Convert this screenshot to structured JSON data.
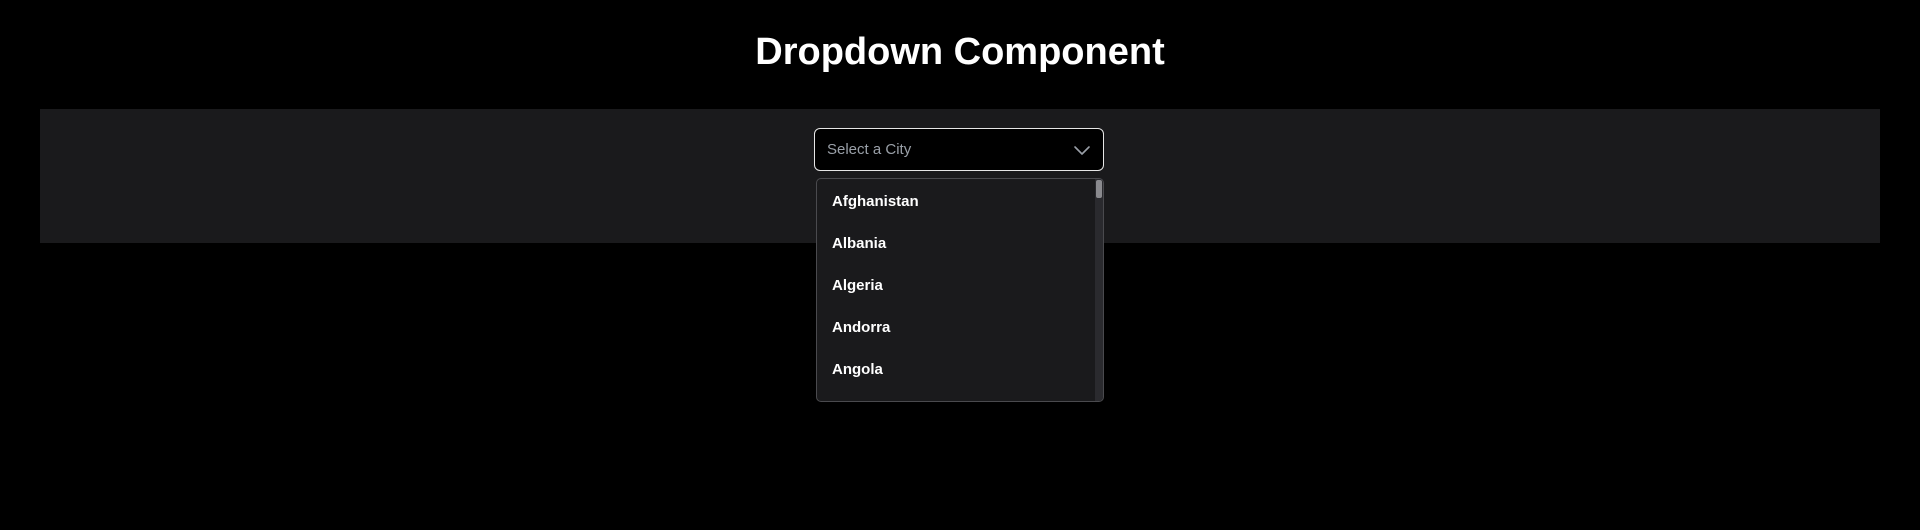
{
  "page": {
    "title": "Dropdown Component"
  },
  "dropdown": {
    "placeholder": "Select a City",
    "toggle_icon": "chevron-down-icon",
    "options": [
      {
        "label": "Afghanistan"
      },
      {
        "label": "Albania"
      },
      {
        "label": "Algeria"
      },
      {
        "label": "Andorra"
      },
      {
        "label": "Angola"
      }
    ]
  },
  "colors": {
    "background": "#000000",
    "panel": "#1a1a1c",
    "text": "#ffffff",
    "placeholder_text": "#9aa0a8",
    "select_border": "#e6e6e6",
    "list_border": "#4a4a4e"
  }
}
